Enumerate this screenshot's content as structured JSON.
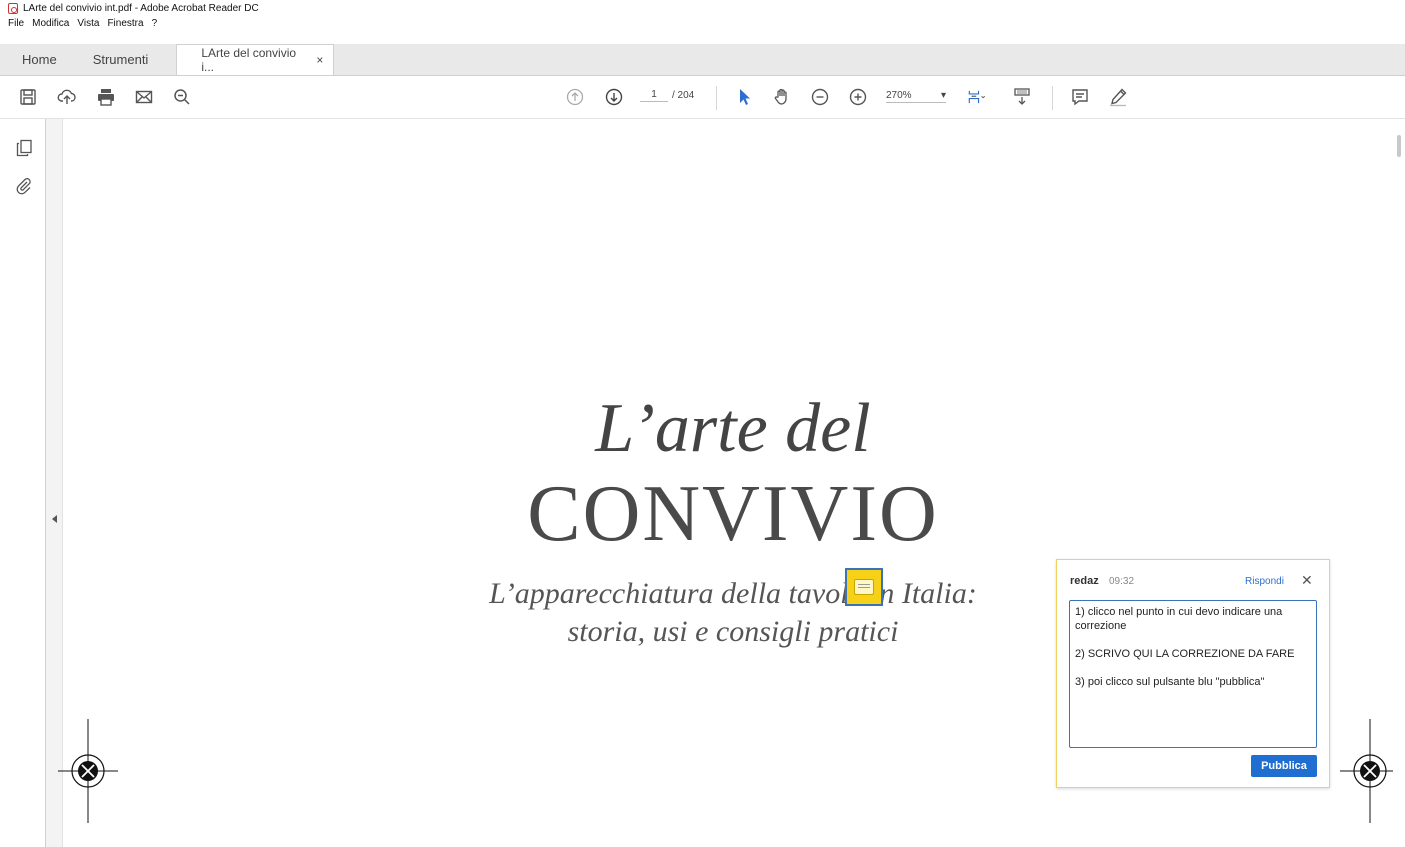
{
  "window": {
    "title": "LArte del convivio int.pdf - Adobe Acrobat Reader DC"
  },
  "menu": [
    "File",
    "Modifica",
    "Vista",
    "Finestra",
    "?"
  ],
  "tabs": {
    "home": "Home",
    "tools": "Strumenti",
    "document": "LArte del convivio i...",
    "close": "×"
  },
  "toolbar": {
    "icons": [
      "save-icon",
      "cloud-upload-icon",
      "print-icon",
      "email-icon",
      "search-icon",
      "page-up-icon",
      "page-down-icon",
      "select-arrow-icon",
      "hand-icon",
      "zoom-out-icon",
      "zoom-in-icon",
      "fit-page-icon",
      "scroll-mode-icon",
      "comment-icon",
      "highlight-pen-icon"
    ],
    "page_current": "1",
    "page_total": "/ 204",
    "zoom": "270%",
    "zoom_dropdown": "▾"
  },
  "sidebar": {
    "icons": [
      "pages-icon",
      "attachment-icon"
    ]
  },
  "document": {
    "line1": "L’arte del",
    "line2": "CONVIVIO",
    "line3": "L’apparecchiatura della tavola in Italia:",
    "line4": "storia, usi e consigli pratici"
  },
  "comment": {
    "author": "redaz",
    "time": "09:32",
    "reply": "Rispondi",
    "close": "✕",
    "text": "1) clicco nel punto in cui devo indicare una correzione\n\n2) SCRIVO QUI LA CORREZIONE DA FARE\n\n3) poi clicco sul pulsante blu \"pubblica\"",
    "button": "Pubblica"
  },
  "colors": {
    "accent": "#1f6fd1",
    "note": "#f7d117",
    "popup_border": "#f2d15c"
  }
}
